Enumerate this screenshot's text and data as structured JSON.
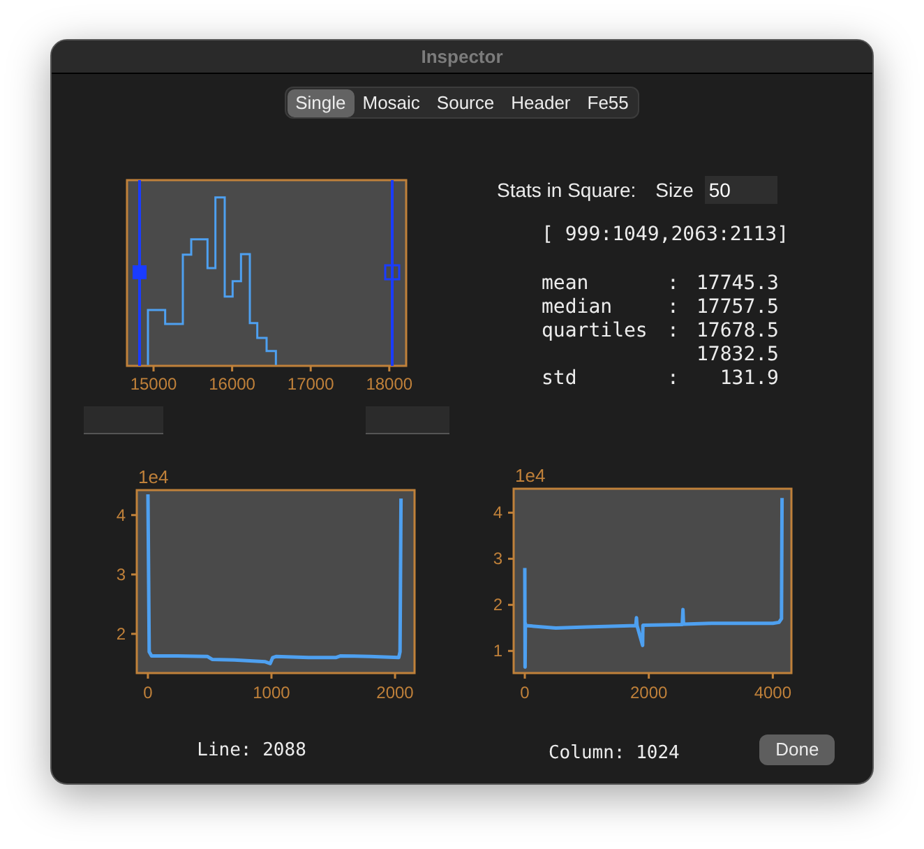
{
  "window": {
    "title": "Inspector"
  },
  "tabs": [
    {
      "label": "Single",
      "selected": true
    },
    {
      "label": "Mosaic",
      "selected": false
    },
    {
      "label": "Source",
      "selected": false
    },
    {
      "label": "Header",
      "selected": false
    },
    {
      "label": "Fe55",
      "selected": false
    }
  ],
  "histogram": {
    "xtick_labels": [
      "15000",
      "16000",
      "17000",
      "18000"
    ]
  },
  "stats": {
    "title": "Stats in Square:",
    "size_label": "Size",
    "size_value": "50",
    "region": "[ 999:1049,2063:2113]",
    "rows": [
      {
        "label": "mean",
        "separator": ":",
        "value": "17745.3"
      },
      {
        "label": "median",
        "separator": ":",
        "value": "17757.5"
      },
      {
        "label": "quartiles",
        "separator": ":",
        "value": "17678.5"
      },
      {
        "value": "17832.5"
      },
      {
        "label": "std",
        "separator": ":",
        "value": "131.9"
      }
    ]
  },
  "line_plot": {
    "offset_label": "1e4",
    "caption": "Line: 2088",
    "chart_data": {
      "type": "line",
      "xlim": [
        -90,
        2158
      ],
      "ylim": [
        1.34,
        4.42
      ],
      "xticks": [
        0,
        1000,
        2000
      ],
      "yticks": [
        2,
        3,
        4
      ],
      "x": [
        0,
        10,
        30,
        200,
        480,
        520,
        700,
        950,
        990,
        1010,
        1040,
        1300,
        1520,
        1560,
        1800,
        2030,
        2040,
        2048
      ],
      "series": [
        {
          "color": "#4ea0f0",
          "values": [
            4.35,
            1.7,
            1.63,
            1.63,
            1.62,
            1.57,
            1.56,
            1.53,
            1.5,
            1.6,
            1.62,
            1.6,
            1.6,
            1.63,
            1.62,
            1.6,
            1.7,
            4.28
          ]
        }
      ]
    }
  },
  "column_plot": {
    "offset_label": "1e4",
    "caption": "Column: 1024",
    "chart_data": {
      "type": "line",
      "xlim": [
        -180,
        4300
      ],
      "ylim": [
        0.52,
        4.52
      ],
      "xticks": [
        0,
        2000,
        4000
      ],
      "yticks": [
        1,
        2,
        3,
        4
      ],
      "x": [
        0,
        5,
        8,
        12,
        20,
        500,
        1000,
        1790,
        1800,
        1810,
        1900,
        1905,
        1910,
        2540,
        2550,
        2560,
        3000,
        4000,
        4100,
        4140,
        4150
      ],
      "series": [
        {
          "color": "#4ea0f0",
          "values": [
            2.8,
            0.65,
            1.6,
            1.52,
            1.55,
            1.5,
            1.52,
            1.55,
            1.72,
            1.55,
            1.12,
            1.55,
            1.56,
            1.57,
            1.9,
            1.58,
            1.6,
            1.6,
            1.62,
            1.7,
            4.32
          ]
        }
      ]
    }
  },
  "buttons": [
    {
      "label": "Done"
    }
  ]
}
